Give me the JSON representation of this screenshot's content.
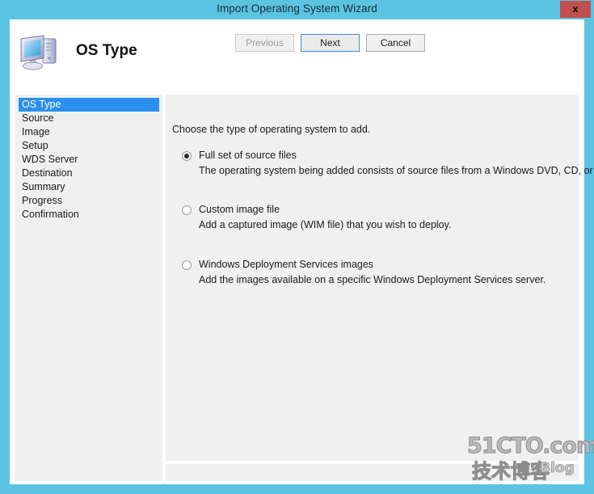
{
  "window": {
    "title": "Import Operating System Wizard",
    "close_label": "x"
  },
  "header": {
    "icon": "computer-icon",
    "title": "OS Type"
  },
  "sidebar": {
    "items": [
      {
        "label": "OS Type",
        "selected": true
      },
      {
        "label": "Source",
        "selected": false
      },
      {
        "label": "Image",
        "selected": false
      },
      {
        "label": "Setup",
        "selected": false
      },
      {
        "label": "WDS Server",
        "selected": false
      },
      {
        "label": "Destination",
        "selected": false
      },
      {
        "label": "Summary",
        "selected": false
      },
      {
        "label": "Progress",
        "selected": false
      },
      {
        "label": "Confirmation",
        "selected": false
      }
    ]
  },
  "content": {
    "intro": "Choose the type of operating system to add.",
    "options": [
      {
        "label": "Full set of source files",
        "description": "The operating system being added consists of source files from a Windows DVD, CD, or equivalent.",
        "checked": true
      },
      {
        "label": "Custom image file",
        "description": "Add a captured image (WIM file) that you wish to deploy.",
        "checked": false
      },
      {
        "label": "Windows Deployment Services images",
        "description": "Add the images available on a specific Windows Deployment Services server.",
        "checked": false
      }
    ]
  },
  "footer": {
    "previous_label": "Previous",
    "next_label": "Next",
    "cancel_label": "Cancel"
  },
  "watermark": {
    "top": "51CTO.com",
    "bottom": "技术博客",
    "blog": "Blog"
  },
  "colors": {
    "frame": "#5bc4e3",
    "selection": "#2a8fef",
    "panel": "#f0f0f0",
    "close": "#c0504d"
  }
}
